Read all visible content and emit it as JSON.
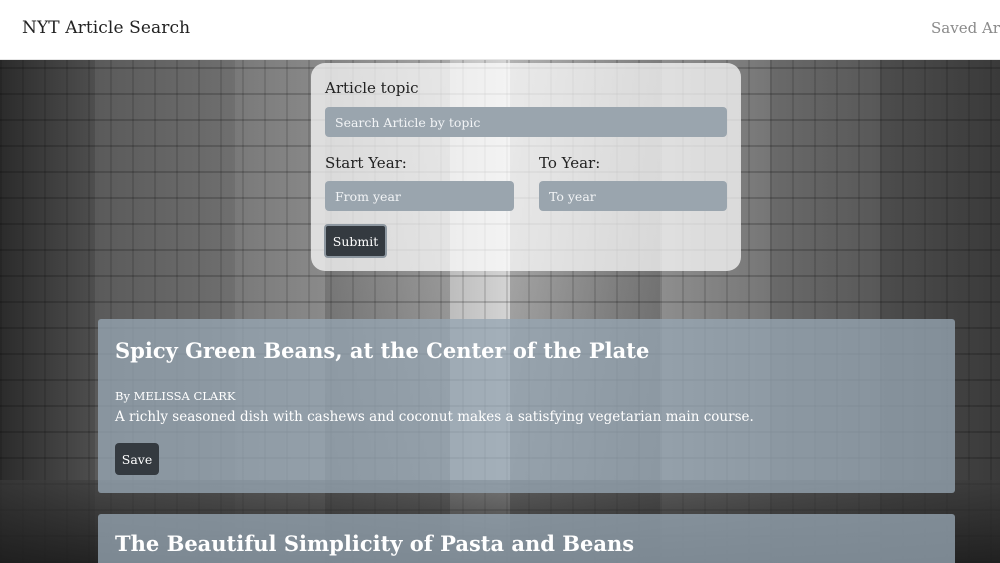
{
  "navbar": {
    "brand": "NYT Article Search",
    "saved_link": "Saved Artic"
  },
  "search": {
    "topic_label": "Article topic",
    "topic_placeholder": "Search Article by topic",
    "start_label": "Start Year:",
    "start_placeholder": "From year",
    "end_label": "To Year:",
    "end_placeholder": "To year",
    "submit_label": "Submit"
  },
  "articles": [
    {
      "title": "Spicy Green Beans, at the Center of the Plate",
      "byline": "By MELISSA CLARK",
      "summary": "A richly seasoned dish with cashews and coconut makes a satisfying vegetarian main course.",
      "save_label": "Save"
    },
    {
      "title": "The Beautiful Simplicity of Pasta and Beans"
    }
  ],
  "colors": {
    "card_bg": "#96a5b2",
    "input_bg": "#9aa5ae",
    "button_bg": "#343a40"
  }
}
